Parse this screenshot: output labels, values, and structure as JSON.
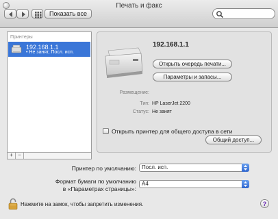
{
  "window": {
    "title": "Печать и факс"
  },
  "toolbar": {
    "show_all_label": "Показать все",
    "search_placeholder": ""
  },
  "printers_list": {
    "header": "Принтеры",
    "items": [
      {
        "name": "192.168.1.1",
        "status": "• Не занят, Посл. исп."
      }
    ]
  },
  "list_controls": {
    "add": "+",
    "remove": "−"
  },
  "detail": {
    "printer_name": "192.168.1.1",
    "open_queue_label": "Открыть очередь печати...",
    "options_label": "Параметры и запасы...",
    "location_label": "Размещение:",
    "location_value": "",
    "type_label": "Тип:",
    "type_value": "HP LaserJet 2200",
    "status_label": "Статус:",
    "status_value": "Не занят",
    "share_label": "Открыть принтер для общего доступа в сети",
    "share_checked": false,
    "sharing_button_label": "Общий доступ..."
  },
  "defaults": {
    "default_printer_label": "Принтер по умолчанию:",
    "default_printer_value": "Посл. исп.",
    "paper_label_line1": "Формат бумаги по умолчанию",
    "paper_label_line2": "в «Параметрах страницы»:",
    "paper_value": "A4"
  },
  "footer": {
    "lock_text": "Нажмите на замок, чтобы запретить изменения.",
    "help": "?"
  },
  "icons": [
    "back-arrow-icon",
    "forward-arrow-icon",
    "grid-icon",
    "search-icon",
    "printer-icon",
    "lock-icon",
    "help-icon"
  ],
  "colors": {
    "selection": "#3a76d8",
    "popup_arrow": "#2e66cf",
    "help_glyph": "#6a2ab0"
  }
}
